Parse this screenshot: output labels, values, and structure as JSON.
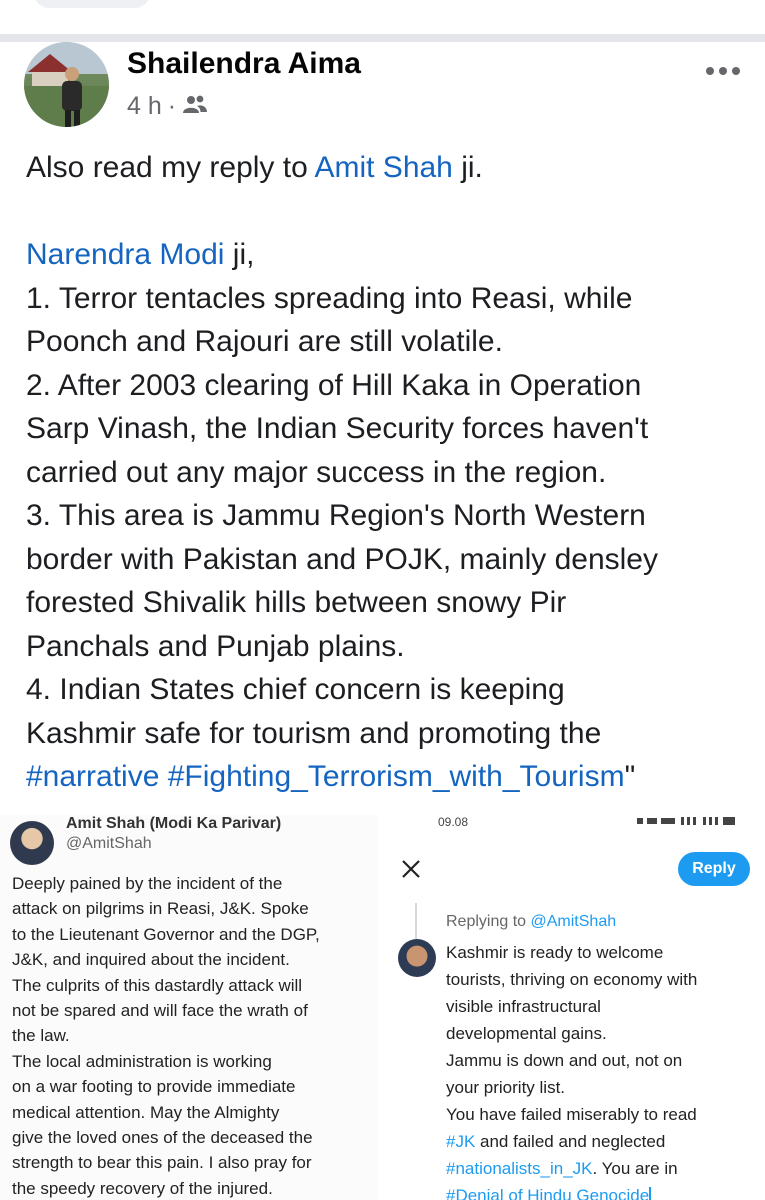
{
  "post": {
    "author": "Shailendra Aima",
    "time": "4 h",
    "dot": "·",
    "more_icon": "more-options-icon",
    "audience_icon": "friends-icon",
    "intro": {
      "pre": "Also read my reply to ",
      "link": "Amit Shah",
      "post": " ji."
    },
    "salutation": {
      "link": "Narendra Modi",
      "post": " ji,"
    },
    "lines": [
      "1. Terror tentacles spreading into Reasi, while",
      "Poonch and Rajouri are still volatile.",
      "2. After 2003 clearing of Hill Kaka in Operation",
      "Sarp Vinash, the Indian Security forces haven't",
      "carried out any major success in the region.",
      "3. This area is Jammu Region's North Western",
      "border with Pakistan and POJK, mainly densley",
      "forested Shivalik hills between snowy Pir",
      "Panchals and Punjab plains.",
      "4. Indian States chief concern is keeping",
      "Kashmir safe for tourism and promoting the"
    ],
    "hashtags": "#narrative #Fighting_Terrorism_with_Tourism",
    "hashtags_suffix": "\""
  },
  "left_shot": {
    "name": "Amit Shah (Modi Ka Parivar)",
    "handle": "@AmitShah",
    "lines": [
      "Deeply pained by the incident of the",
      "attack on pilgrims in Reasi, J&K. Spoke",
      "to the Lieutenant Governor and the DGP,",
      "J&K, and inquired about the incident.",
      "The culprits of this dastardly attack will",
      "not be spared and will face the wrath of",
      "the law.",
      "The local administration is working",
      "on a war footing to provide immediate",
      "medical attention. May the Almighty",
      "give the loved ones of the deceased the",
      "strength to bear this pain. I also pray for",
      "the speedy recovery of the injured."
    ]
  },
  "right_shot": {
    "status_time": "09.08",
    "close_icon": "close-icon",
    "reply_label": "Reply",
    "replying_to": "Replying to ",
    "replying_handle": "@AmitShah",
    "lines": [
      "Kashmir is ready to welcome",
      "tourists,  thriving on economy with",
      "visible infrastructural",
      "developmental gains.",
      "Jammu is down and out, not on",
      "your priority list.",
      "You have failed miserably to read"
    ],
    "line8": {
      "tag": "#JK",
      "rest": " and failed and neglected"
    },
    "line9": {
      "tag": "#nationalists_in_JK",
      "rest": ". You are in"
    },
    "line10": {
      "tag": "#Denial of Hindu Genocide"
    }
  },
  "colors": {
    "link": "#1565c0",
    "twitter_blue": "#1d9bf0",
    "separator": "#e4e6eb"
  }
}
